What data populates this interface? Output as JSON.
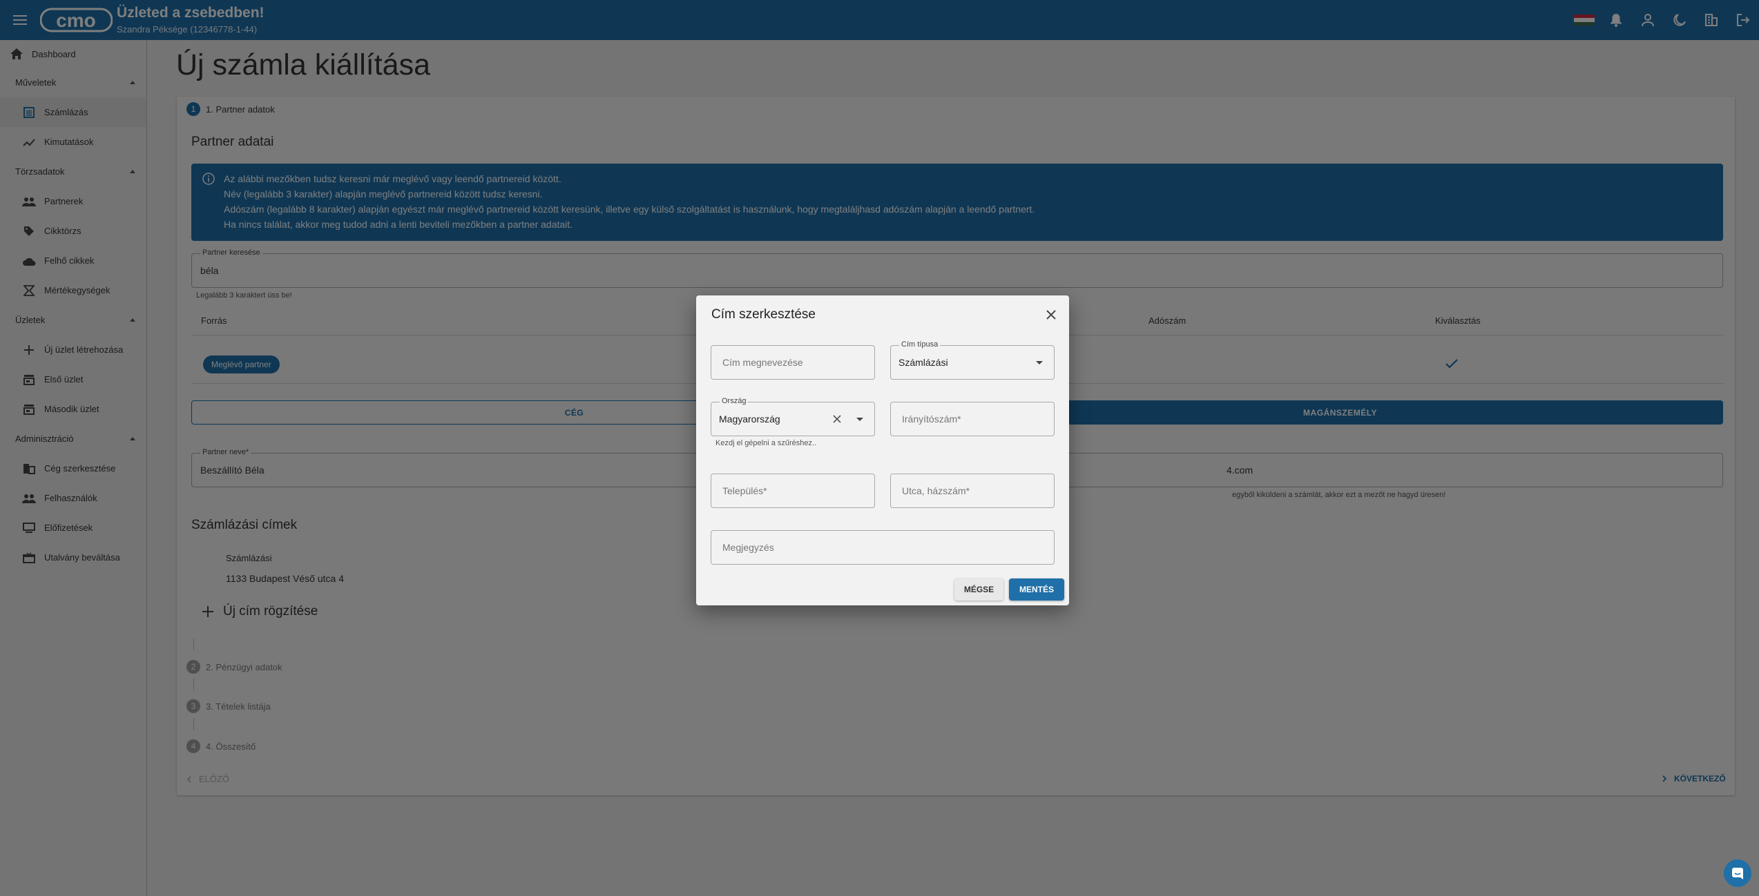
{
  "header": {
    "logo_text": "cmo",
    "title": "Üzleted a zsebedben!",
    "subtitle": "Szandra Péksége (12346778-1-44)"
  },
  "sidebar": {
    "dashboard": "Dashboard",
    "sections": {
      "muveletek": "Műveletek",
      "torzsadatok": "Törzsadatok",
      "uzletek": "Üzletek",
      "adminisztracio": "Adminisztráció"
    },
    "items": {
      "szamlazas": "Számlázás",
      "kimutatasok": "Kimutatások",
      "partnerek": "Partnerek",
      "cikktorzs": "Cikktörzs",
      "felho_cikkek": "Felhő cikkek",
      "mertekegysegek": "Mértékegységek",
      "uj_uzlet": "Új üzlet létrehozása",
      "elso_uzlet": "Első üzlet",
      "masodik_uzlet": "Második üzlet",
      "ceg_szerkesztese": "Cég szerkesztése",
      "felhasznalok": "Felhasználók",
      "elofizetesek": "Előfizetések",
      "utalvany": "Utalvány beváltása"
    }
  },
  "main": {
    "page_title": "Új számla kiállítása",
    "step1": "1. Partner adatok",
    "partner_adatai": "Partner adatai",
    "info_lines": [
      "Az alábbi mezőkben tudsz keresni már meglévő vagy leendő partnereid között.",
      "Név (legalább 3 karakter) alapján meglévő partnereid között tudsz keresni.",
      "Adószám (legalább 8 karakter) alapján egyészt már meglévő partnereid között keresünk, illetve egy külső szolgáltatást is használunk, hogy megtaláljhasd adószám alapján a leendő partnert.",
      "Ha nincs találat, akkor meg tudod adni a lenti beviteli mezőkben a partner adatait."
    ],
    "search_label": "Partner keresése",
    "search_value": "béla",
    "search_helper": "Legalább 3 karaktert üss be!",
    "table_headers": {
      "forras": "Forrás",
      "adoszam": "Adószám",
      "kivalasztas": "Kiválasztás"
    },
    "chip_label": "Meglévő partner",
    "toggle_ceg": "CÉG",
    "toggle_maganszemely": "MAGÁNSZEMÉLY",
    "partner_nev_label": "Partner neve*",
    "partner_nev_value": "Beszállító Béla",
    "email_value_fragment": "4.com",
    "email_helper_fragment": "egyből kiküldeni a számlát, akkor ezt a mezőt ne hagyd üresen!",
    "szamlazasi_cimek": "Számlázási címek",
    "address_type": "Számlázási",
    "address_value": "1133 Budapest Véső utca 4",
    "new_address": "Új cím rögzítése",
    "step2": "2. Pénzügyi adatok",
    "step3": "3. Tételek listája",
    "step4": "4. Összesítő",
    "step2_num": "2",
    "step3_num": "3",
    "step4_num": "4",
    "step1_num": "1",
    "prev": "ELŐZŐ",
    "next": "KÖVETKEZŐ"
  },
  "dialog": {
    "title": "Cím szerkesztése",
    "cim_megnevezese_placeholder": "Cím megnevezése",
    "cim_tipusa_label": "Cím típusa",
    "cim_tipusa_value": "Számlázási",
    "orszag_label": "Ország",
    "orszag_value": "Magyarország",
    "orszag_helper": "Kezdj el gépelni a szűréshez..",
    "iranyitoszam_placeholder": "Irányítószám*",
    "telepules_placeholder": "Település*",
    "utca_placeholder": "Utca, házszám*",
    "megjegyzes_placeholder": "Megjegyzés",
    "cancel": "MÉGSE",
    "save": "MENTÉS"
  },
  "colors": {
    "primary": "#1f6fa8",
    "flag_red": "#cd2a3e",
    "flag_white": "#ffffff",
    "flag_green": "#436f4d"
  }
}
